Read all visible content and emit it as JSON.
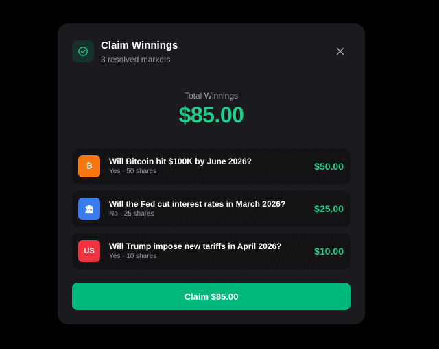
{
  "header": {
    "title": "Claim Winnings",
    "subtitle": "3 resolved markets",
    "icon": "check-circle-icon",
    "close_icon": "close-icon"
  },
  "total": {
    "label": "Total Winnings",
    "amount": "$85.00"
  },
  "markets": [
    {
      "icon": "bitcoin-icon",
      "icon_glyph": "₿",
      "icon_color": "#f7760f",
      "question": "Will Bitcoin hit $100K by June 2026?",
      "meta": "Yes · 50 shares",
      "amount": "$50.00"
    },
    {
      "icon": "bank-icon",
      "icon_glyph": "🏛",
      "icon_color": "#3b7bf0",
      "question": "Will the Fed cut interest rates in March 2026?",
      "meta": "No · 25 shares",
      "amount": "$25.00"
    },
    {
      "icon": "us-flag-icon",
      "icon_glyph": "US",
      "icon_color": "#ef3340",
      "question": "Will Trump impose new tariffs in April 2026?",
      "meta": "Yes · 10 shares",
      "amount": "$10.00"
    }
  ],
  "claim_button": {
    "label": "Claim $85.00"
  },
  "colors": {
    "accent_green": "#1fce89",
    "button_green": "#00b87c",
    "modal_bg": "#1b1b1f",
    "row_bg": "#121215"
  }
}
